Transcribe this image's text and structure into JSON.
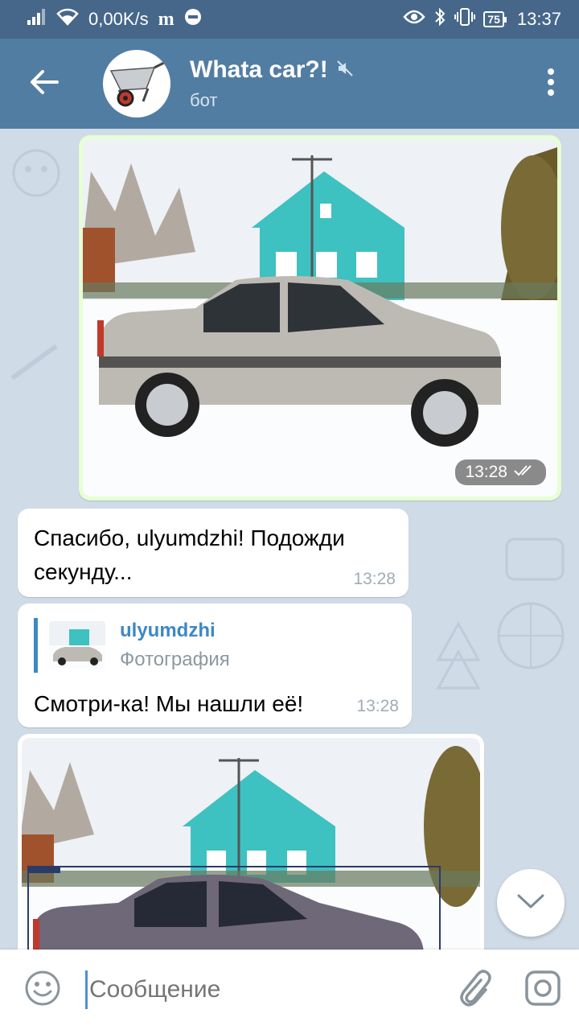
{
  "statusbar": {
    "net_speed": "0,00K/s",
    "battery": "75",
    "time": "13:37",
    "icons": [
      "signal-icon",
      "wifi-icon",
      "m-icon",
      "circle-icon",
      "eye-icon",
      "bluetooth-icon",
      "vibrate-icon"
    ]
  },
  "header": {
    "title": "Whata car?!",
    "subtitle": "бот",
    "icons": [
      "back-arrow-icon",
      "muted-icon",
      "more-vert-icon"
    ],
    "colors": {
      "statusbar": "#46678a",
      "header": "#527da3"
    }
  },
  "messages": [
    {
      "type": "photo",
      "direction": "out",
      "time": "13:28",
      "status": "read"
    },
    {
      "type": "text",
      "direction": "in",
      "text": "Спасибо, ulyumdzhi! Подожди секунду...",
      "time": "13:28"
    },
    {
      "type": "reply",
      "direction": "in",
      "reply_name": "ulyumdzhi",
      "reply_desc": "Фотография",
      "text": "Смотри-ка! Мы нашли её!",
      "time": "13:28"
    },
    {
      "type": "photo",
      "direction": "in"
    }
  ],
  "input": {
    "placeholder": "Сообщение",
    "icons": [
      "emoji-icon",
      "attach-icon",
      "camera-icon"
    ]
  }
}
